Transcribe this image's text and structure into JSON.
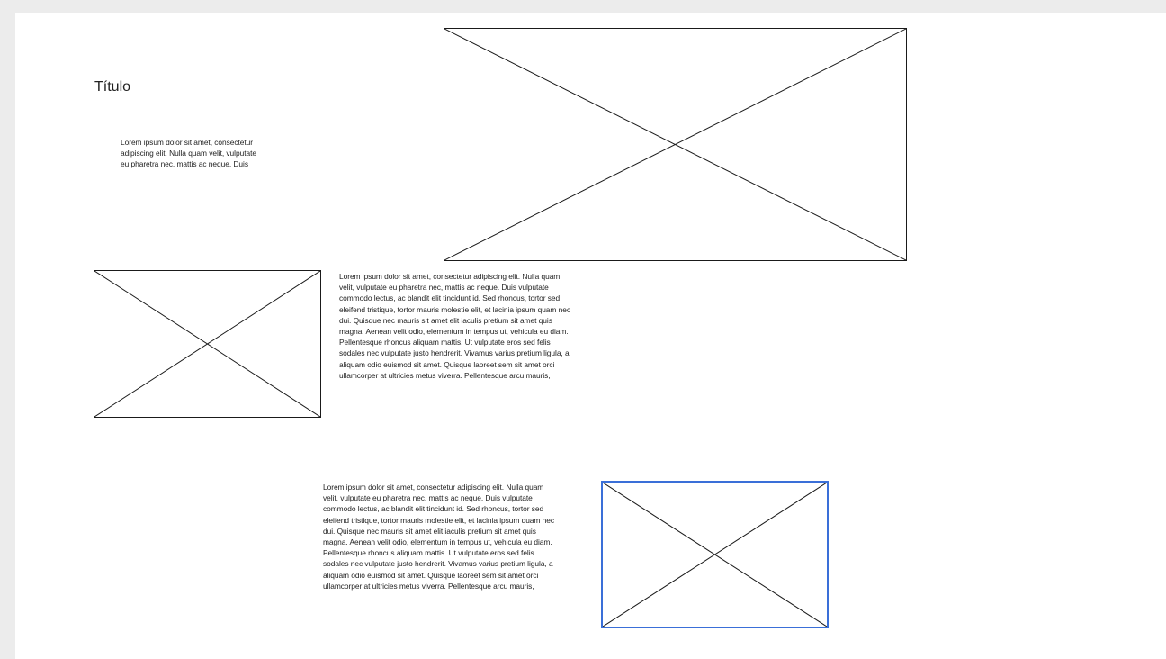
{
  "page": {
    "title": "Título"
  },
  "paragraphs": {
    "short": [
      "Lorem ipsum dolor sit amet, consectetur",
      "adipiscing elit. Nulla quam velit, vulputate",
      "eu pharetra nec, mattis ac neque. Duis"
    ],
    "middle": [
      "Lorem ipsum dolor sit amet, consectetur adipiscing elit. Nulla quam",
      "velit, vulputate eu pharetra nec, mattis ac neque. Duis vulputate",
      "commodo lectus, ac blandit elit tincidunt id. Sed rhoncus, tortor sed",
      "eleifend tristique, tortor mauris molestie elit, et lacinia ipsum quam nec",
      "dui. Quisque nec mauris sit amet elit iaculis pretium sit amet quis",
      "magna. Aenean velit odio, elementum in tempus ut, vehicula eu diam.",
      "Pellentesque rhoncus aliquam mattis. Ut vulputate eros sed felis",
      "sodales nec vulputate justo hendrerit. Vivamus varius pretium ligula, a",
      "aliquam odio euismod sit amet. Quisque laoreet sem sit amet orci",
      "ullamcorper at ultricies metus viverra. Pellentesque arcu mauris,"
    ],
    "bottom": [
      "Lorem ipsum dolor sit amet, consectetur adipiscing elit. Nulla quam",
      "velit, vulputate eu pharetra nec, mattis ac neque. Duis vulputate",
      "commodo lectus, ac blandit elit tincidunt id. Sed rhoncus, tortor sed",
      "eleifend tristique, tortor mauris molestie elit, et lacinia ipsum quam nec",
      "dui. Quisque nec mauris sit amet elit iaculis pretium sit amet quis",
      "magna. Aenean velit odio, elementum in tempus ut, vehicula eu diam.",
      "Pellentesque rhoncus aliquam mattis. Ut vulputate eros sed felis",
      "sodales nec vulputate justo hendrerit. Vivamus varius pretium ligula, a",
      "aliquam odio euismod sit amet. Quisque laoreet sem sit amet orci",
      "ullamcorper at ultricies metus viverra. Pellentesque arcu mauris,"
    ]
  },
  "colors": {
    "page_background": "#ececec",
    "canvas_background": "#ffffff",
    "stroke": "#1a1a1a",
    "selection": "#3a6fd8"
  },
  "placeholders": {
    "hero": {
      "icon": "image-placeholder-icon",
      "selected": false
    },
    "left": {
      "icon": "image-placeholder-icon",
      "selected": false
    },
    "bottom": {
      "icon": "image-placeholder-icon",
      "selected": true
    }
  }
}
